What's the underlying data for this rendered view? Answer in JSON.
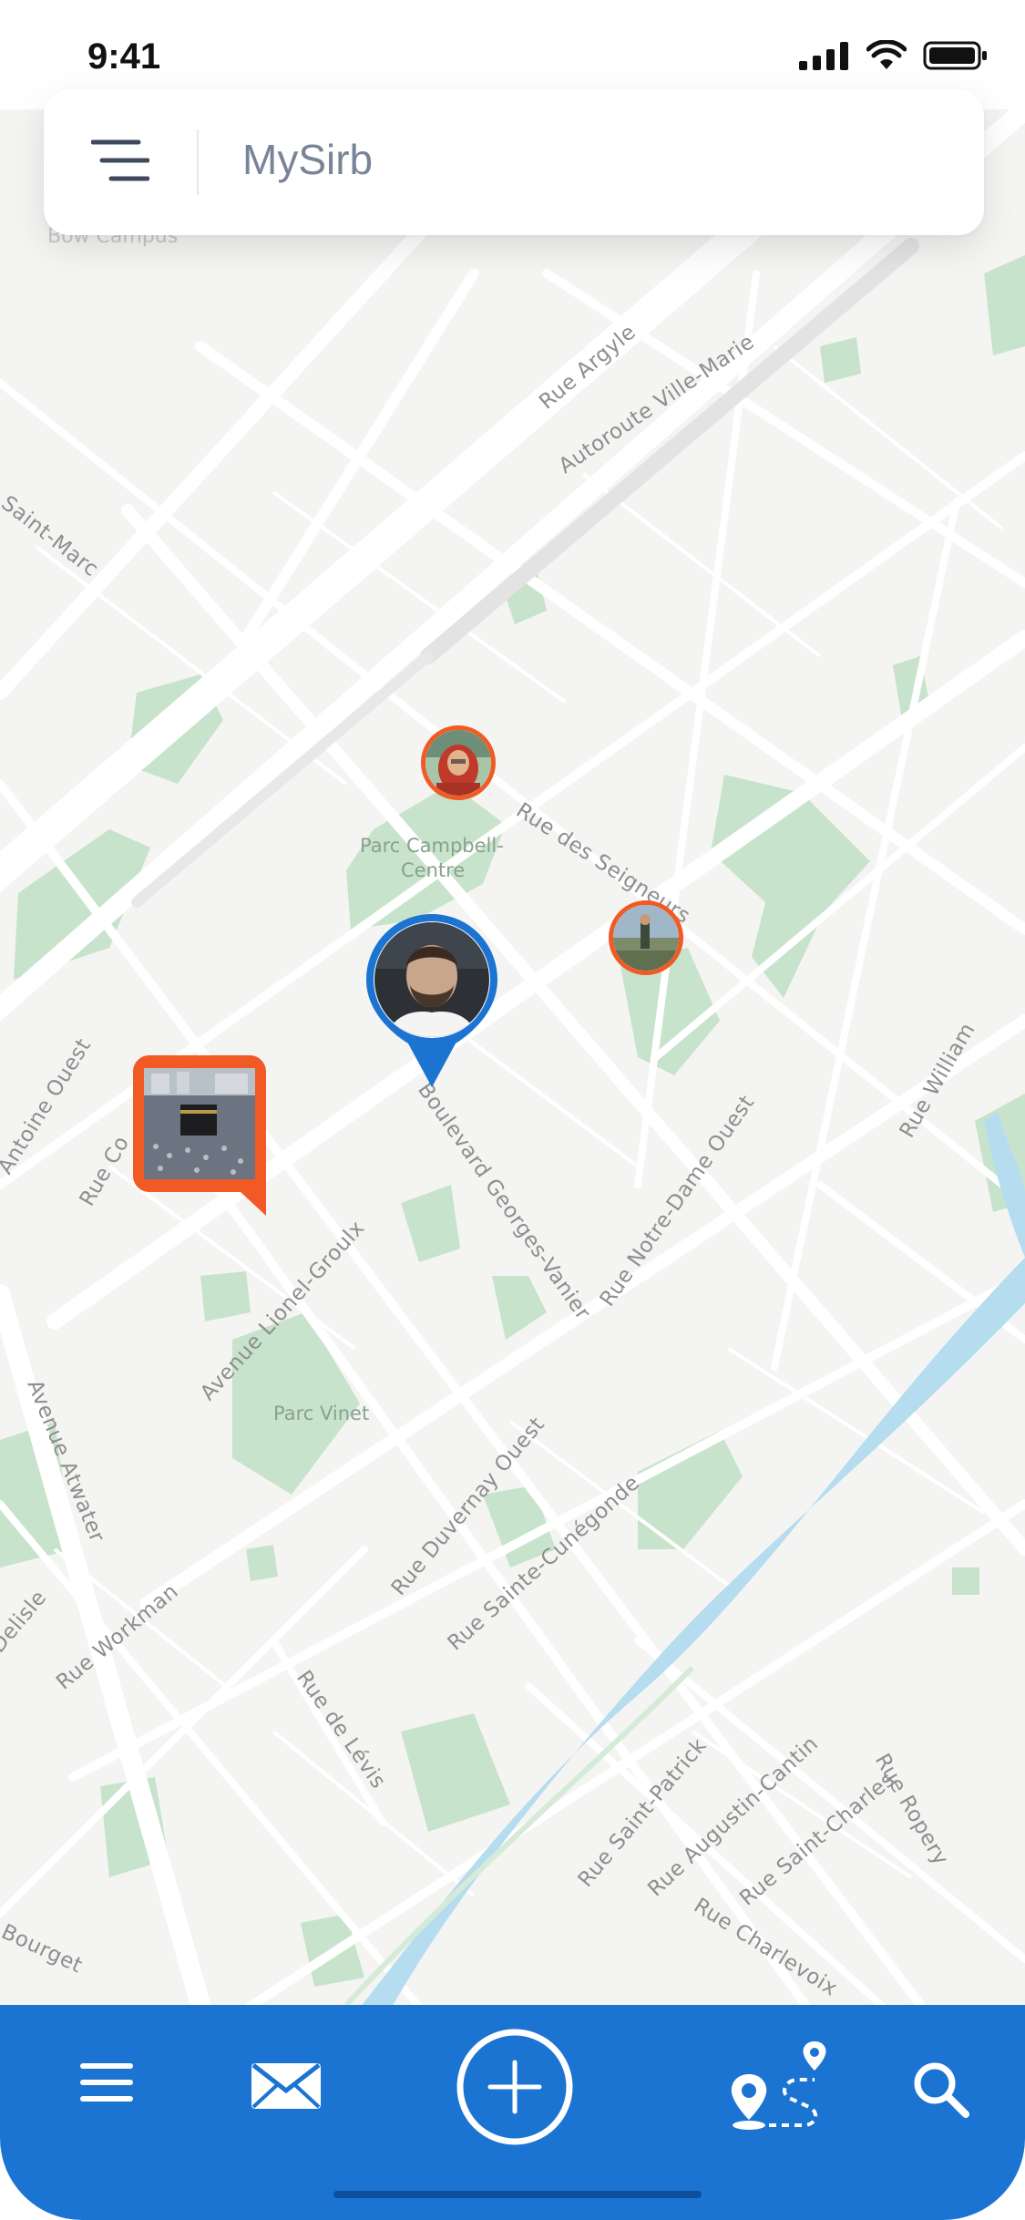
{
  "status_bar": {
    "time": "9:41"
  },
  "header": {
    "title": "MySirb"
  },
  "map": {
    "faded_top_label": "Bow Campus",
    "streets": [
      "Rue Argyle",
      "Autoroute Ville-Marie",
      "Saint-Marc",
      "Rue des Seigneurs",
      "Antoine Ouest",
      "Rue Co",
      "Boulevard Georges-Vanier",
      "Rue Notre-Dame Ouest",
      "Rue William",
      "Avenue Lionel-Groulx",
      "Avenue Atwater",
      "Rue Duvernay Ouest",
      "Rue Sainte-Cunégonde",
      "Delisle",
      "Rue Workman",
      "Rue de Lévis",
      "Rue Saint-Patrick",
      "Rue Augustin-Cantin",
      "Rue Saint-Charles",
      "Rue Ropery",
      "Rue Charlevoix",
      "Bourget"
    ],
    "parks": [
      "Parc Campbell-",
      "Centre",
      "Parc Vinet"
    ]
  },
  "markers": {
    "user_pin": "current-user",
    "avatar_1": "woman-in-red-hijab",
    "avatar_2": "outdoor-photo",
    "post_pin": "kaaba-photo"
  },
  "colors": {
    "brand_blue": "#1c74d2",
    "accent_orange": "#f15a24",
    "park_green": "#c8e3cc",
    "water_blue": "#b6dcf0",
    "map_bg": "#f4f4f2"
  },
  "bottom_nav": {
    "items": [
      "menu-icon",
      "mail-icon",
      "add-icon",
      "route-icon",
      "search-icon"
    ]
  }
}
